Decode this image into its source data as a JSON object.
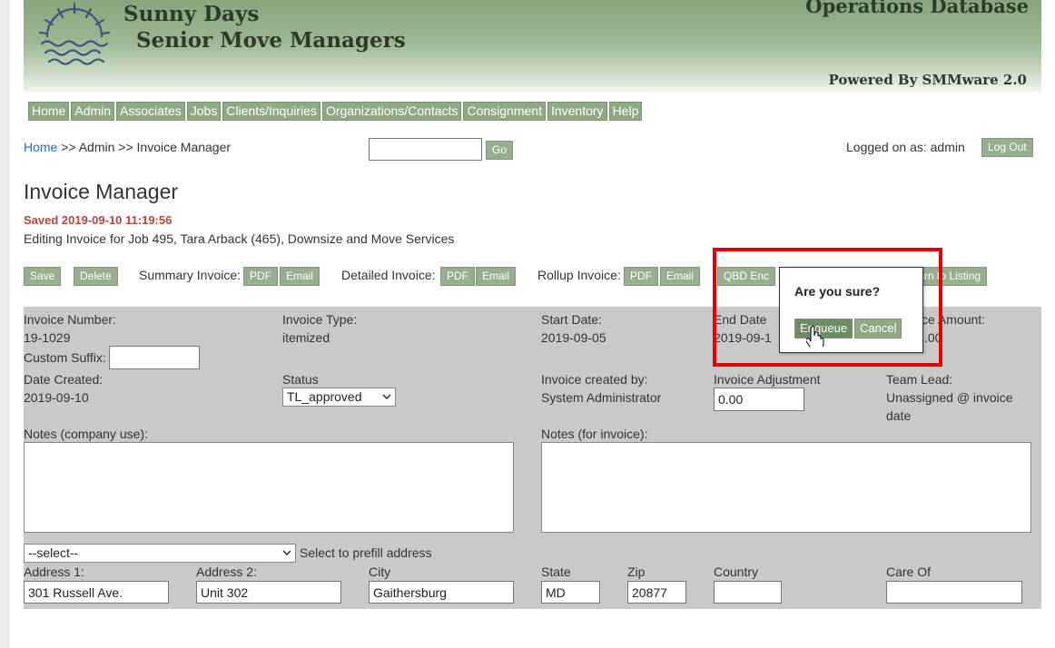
{
  "header": {
    "brand_line1": "Sunny Days",
    "brand_line2": "Senior Move Managers",
    "app_title": "Operations Database",
    "powered_by": "Powered By SMMware 2.0"
  },
  "nav": [
    "Home",
    "Admin",
    "Associates",
    "Jobs",
    "Clients/Inquiries",
    "Organizations/Contacts",
    "Consignment",
    "Inventory",
    "Help"
  ],
  "breadcrumb": {
    "home": "Home",
    "rest": " >> Admin >> Invoice Manager"
  },
  "search": {
    "value": "",
    "go_label": "Go"
  },
  "session": {
    "logged_on": "Logged on as: admin",
    "logout_label": "Log Out"
  },
  "page": {
    "title": "Invoice Manager",
    "saved_status": "Saved 2019-09-10 11:19:56",
    "editing": "Editing Invoice for Job 495, Tara Arback (465), Downsize and Move Services"
  },
  "toolbar": {
    "save": "Save",
    "delete": "Delete",
    "summary_label": "Summary Invoice:",
    "detailed_label": "Detailed Invoice:",
    "rollup_label": "Rollup Invoice:",
    "pdf": "PDF",
    "email": "Email",
    "qbd_partial": "QBD Enc",
    "return_partial": "turn to Listing"
  },
  "form": {
    "invoice_number_label": "Invoice Number:",
    "invoice_number": "19-1029",
    "invoice_type_label": "Invoice Type:",
    "invoice_type": "itemized",
    "start_date_label": "Start Date:",
    "start_date": "2019-09-05",
    "end_date_label": "End Date",
    "end_date_partial": "2019-09-1",
    "invoice_amount_label_partial": "ce Amount:",
    "invoice_amount_partial": ".00",
    "custom_suffix_label": "Custom Suffix:",
    "custom_suffix": "",
    "date_created_label": "Date Created:",
    "date_created": "2019-09-10",
    "status_label": "Status",
    "status_value": "TL_approved",
    "created_by_label": "Invoice created by:",
    "created_by": "System Administrator",
    "adjustment_label": "Invoice Adjustment",
    "adjustment_value": "0.00",
    "team_lead_label": "Team Lead:",
    "team_lead_line1": "Unassigned @ invoice",
    "team_lead_line2": "date",
    "notes_company_label": "Notes (company use):",
    "notes_invoice_label": "Notes (for invoice):",
    "prefill_value": "--select--",
    "prefill_label": "Select to prefill address",
    "address1_label": "Address 1:",
    "address1": "301 Russell Ave.",
    "address2_label": "Address 2:",
    "address2": "Unit 302",
    "city_label": "City",
    "city": "Gaithersburg",
    "state_label": "State",
    "state": "MD",
    "zip_label": "Zip",
    "zip": "20877",
    "country_label": "Country",
    "country": "",
    "care_of_label": "Care Of",
    "care_of": ""
  },
  "dialog": {
    "question": "Are you sure?",
    "confirm": "Enqueue",
    "cancel": "Cancel"
  },
  "colors": {
    "accent": "#8fa987",
    "highlight_box": "#e00000",
    "saved_text": "#b5473a",
    "form_bg": "#c9c9c9"
  }
}
